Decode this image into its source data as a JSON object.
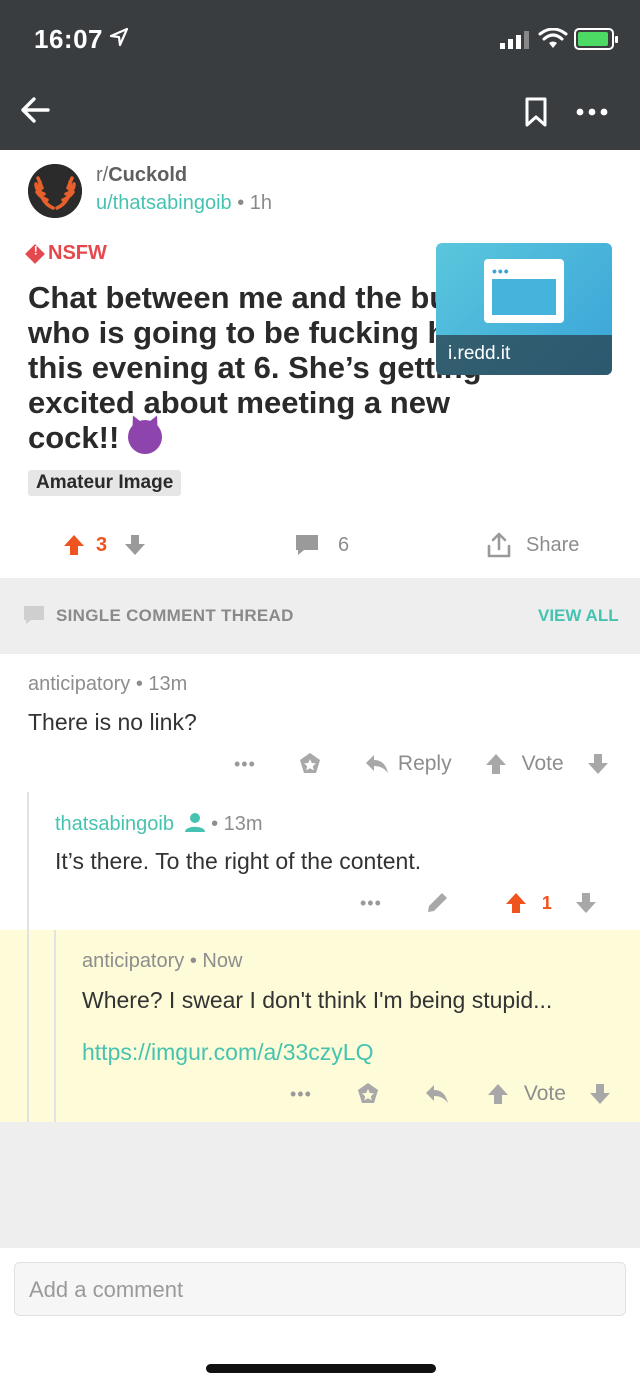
{
  "status_bar": {
    "time": "16:07"
  },
  "post": {
    "subreddit_prefix": "r/",
    "subreddit": "Cuckold",
    "author": "u/thatsabingoib",
    "age": "• 1h",
    "nsfw_label": "NSFW",
    "title": "Chat between me and the bull who is going to be fucking her this evening at 6. She’s getting excited about meeting a new cock!!",
    "title_emoji": "devil-emoji",
    "thumbnail_caption": "i.redd.it",
    "flair": "Amateur Image",
    "score": "3",
    "comments_count": "6",
    "share_label": "Share"
  },
  "thread": {
    "header": "SINGLE COMMENT THREAD",
    "view_all": "VIEW ALL"
  },
  "comments": [
    {
      "author": "anticipatory",
      "age": "• 13m",
      "body": "There is no link?",
      "reply_label": "Reply",
      "vote_label": "Vote"
    },
    {
      "author": "thatsabingoib",
      "age": "• 13m",
      "body": "It’s there.  To the right of the content.",
      "score": "1"
    },
    {
      "author": "anticipatory",
      "age": "• Now",
      "body": "Where? I swear I don't think I'm being stupid...",
      "link": "https://imgur.com/a/33czyLQ",
      "vote_label": "Vote"
    }
  ],
  "composer": {
    "placeholder": "Add a comment"
  },
  "colors": {
    "accent": "#46c3b0",
    "upvote": "#f0541e",
    "nsfw": "#e5484d",
    "topbar": "#3a3d40",
    "highlight": "#fefbd8"
  }
}
